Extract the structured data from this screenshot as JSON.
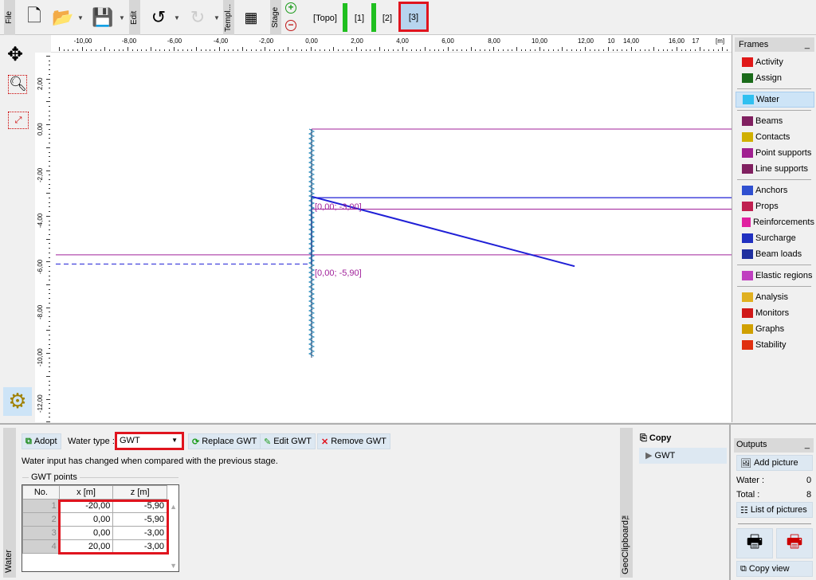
{
  "toolbar": {
    "file": "File",
    "edit": "Edit",
    "templates": "Templ...",
    "stage": "Stage",
    "stages": [
      "[Topo]",
      "[1]",
      "[2]",
      "[3]"
    ],
    "active_stage": "[3]"
  },
  "ruler": {
    "x_ticks": [
      "-10,00",
      "-8,00",
      "-6,00",
      "-4,00",
      "-2,00",
      "0,00",
      "2,00",
      "4,00",
      "6,00",
      "8,00",
      "10,00",
      "12,00",
      "10",
      "14,00",
      "16,00",
      "17"
    ],
    "x_unit": "[m]",
    "y_ticks": [
      "2,00",
      "0,00",
      "-2,00",
      "-4,00",
      "-6,00",
      "-8,00",
      "-10,00",
      "-12,00"
    ]
  },
  "canvas": {
    "labels": [
      "[0,00; -3,00]",
      "[0,00; -5,90]"
    ],
    "colors": {
      "interface": "#a0209a",
      "water": "#1f1fd6",
      "wall": "#2a8fbf"
    }
  },
  "frames": {
    "title": "Frames",
    "collapse": "_",
    "items": [
      {
        "label": "Activity",
        "icon": "activity-icon",
        "group": 1
      },
      {
        "label": "Assign",
        "icon": "assign-icon",
        "group": 1
      },
      {
        "label": "Water",
        "icon": "water-icon",
        "group": 2,
        "selected": true
      },
      {
        "label": "Beams",
        "icon": "beams-icon",
        "group": 3
      },
      {
        "label": "Contacts",
        "icon": "contacts-icon",
        "group": 3
      },
      {
        "label": "Point supports",
        "icon": "point-supports-icon",
        "group": 3
      },
      {
        "label": "Line supports",
        "icon": "line-supports-icon",
        "group": 3
      },
      {
        "label": "Anchors",
        "icon": "anchors-icon",
        "group": 4
      },
      {
        "label": "Props",
        "icon": "props-icon",
        "group": 4
      },
      {
        "label": "Reinforcements",
        "icon": "reinforcements-icon",
        "group": 4
      },
      {
        "label": "Surcharge",
        "icon": "surcharge-icon",
        "group": 4
      },
      {
        "label": "Beam loads",
        "icon": "beam-loads-icon",
        "group": 4
      },
      {
        "label": "Elastic regions",
        "icon": "elastic-regions-icon",
        "group": 5
      },
      {
        "label": "Analysis",
        "icon": "analysis-icon",
        "group": 6
      },
      {
        "label": "Monitors",
        "icon": "monitors-icon",
        "group": 6
      },
      {
        "label": "Graphs",
        "icon": "graphs-icon",
        "group": 6
      },
      {
        "label": "Stability",
        "icon": "stability-icon",
        "group": 6
      }
    ]
  },
  "water": {
    "side_label": "Water",
    "adopt": "Adopt",
    "type_label": "Water type :",
    "type_value": "GWT",
    "replace": "Replace GWT",
    "edit": "Edit GWT",
    "remove": "Remove GWT",
    "message": "Water input has changed when compared with the previous stage.",
    "group_title": "GWT points",
    "columns": [
      "No.",
      "x [m]",
      "z [m]"
    ],
    "rows": [
      [
        "1",
        "-20,00",
        "-5,90"
      ],
      [
        "2",
        "0,00",
        "-5,90"
      ],
      [
        "3",
        "0,00",
        "-3,00"
      ],
      [
        "4",
        "20,00",
        "-3,00"
      ]
    ]
  },
  "clipboard": {
    "side_label": "GeoClipboard™",
    "copy": "Copy",
    "item": "GWT"
  },
  "outputs": {
    "title": "Outputs",
    "collapse": "_",
    "add_picture": "Add picture",
    "water_label": "Water :",
    "water_count": "0",
    "total_label": "Total :",
    "total_count": "8",
    "list": "List of pictures",
    "copy_view": "Copy view"
  }
}
